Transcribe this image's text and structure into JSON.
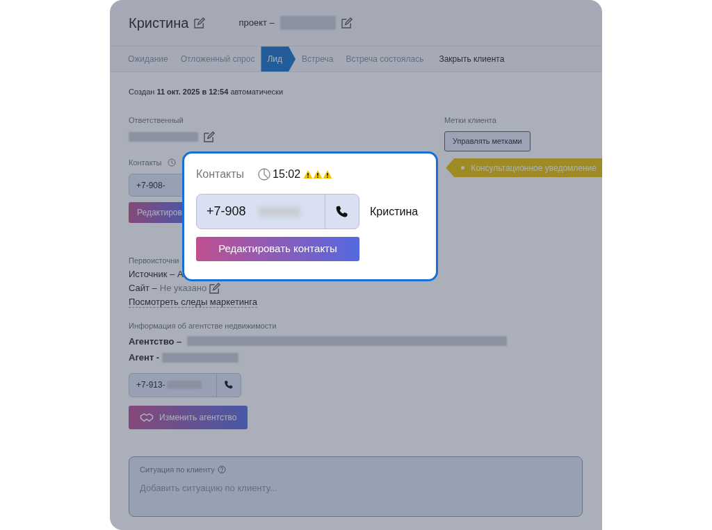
{
  "header": {
    "title": "Кристина",
    "project_label": "проект –"
  },
  "tabs": [
    {
      "label": "Ожидание",
      "kind": "stage",
      "selected": false
    },
    {
      "label": "Отложенный спрос",
      "kind": "stage",
      "selected": false
    },
    {
      "label": "Лид",
      "kind": "stage",
      "selected": true
    },
    {
      "label": "Встреча",
      "kind": "stage",
      "selected": false
    },
    {
      "label": "Встреча состоялась",
      "kind": "stage",
      "selected": false
    },
    {
      "label": "Закрыть клиента",
      "kind": "action",
      "selected": false
    }
  ],
  "created": "Создан **11 окт. 2025 в 12:54** автоматически",
  "responsible": {
    "label": "Ответственный"
  },
  "tags": {
    "label": "Метки клиента",
    "button": "Управлять метками",
    "items": [
      {
        "label": "Консультационное уведомление"
      }
    ]
  },
  "contacts": {
    "label": "Контакты",
    "phone": "+7-908-",
    "edit_button": "Редактиров"
  },
  "source": {
    "label": "Первоисточни",
    "source_line": "Источник – А",
    "site_label": "Сайт –",
    "site_value": "Не указано",
    "marketing_link": "Посмотреть следы маркетинга"
  },
  "agency": {
    "label": "Информация об агентстве недвижимости",
    "agency_label": "Агентство –",
    "agent_label": "Агент -",
    "phone": "+7-913-",
    "change_button": "Изменить агентство"
  },
  "situation": {
    "label": "Ситуация по клиенту",
    "placeholder": "Добавить ситуацию по клиенту..."
  },
  "popup": {
    "title": "Контакты",
    "time": "15:02",
    "warnings": [
      {
        "kind": "warning"
      },
      {
        "kind": "warning"
      },
      {
        "kind": "warning"
      }
    ],
    "phone": "+7-908",
    "contact_name": "Кристина",
    "edit_button": "Редактировать контакты"
  }
}
